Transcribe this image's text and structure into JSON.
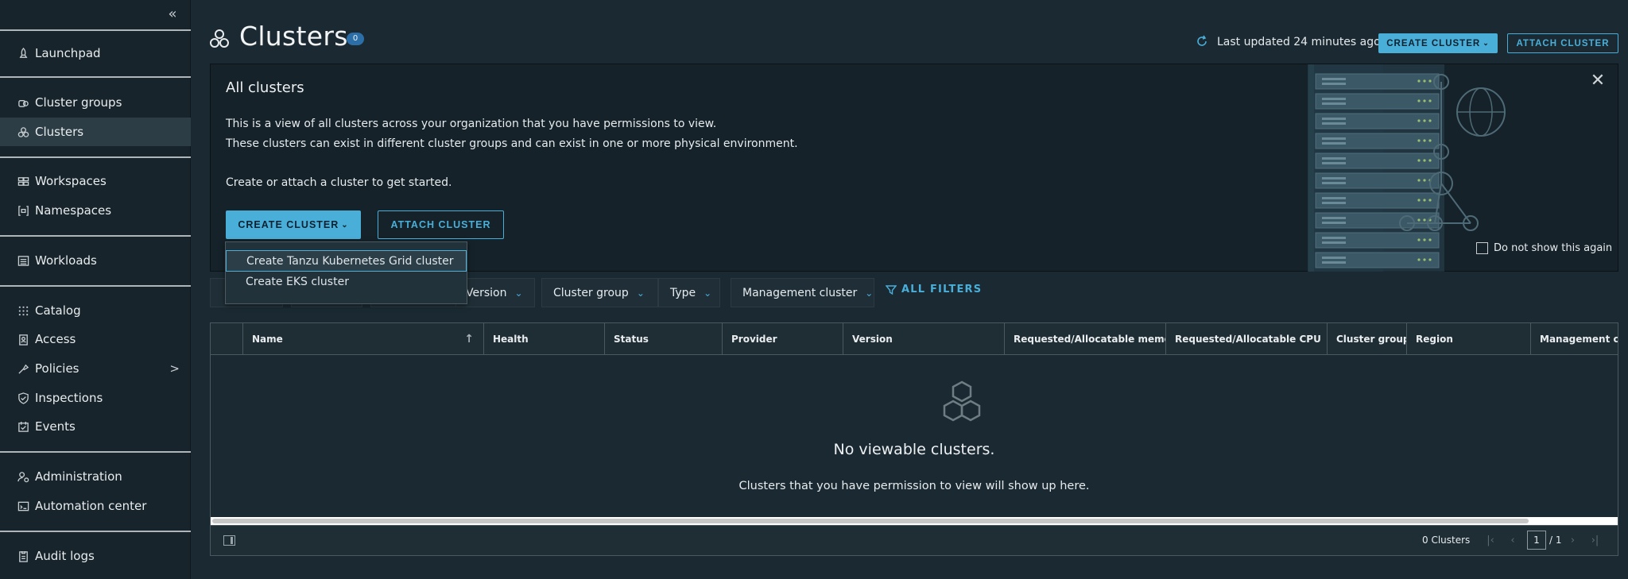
{
  "sidebar": {
    "collapse_icon": "double-chevron-left-icon",
    "items": [
      {
        "label": "Launchpad",
        "icon": "rocket-icon"
      },
      {
        "label": "Cluster groups",
        "icon": "cluster-groups-icon"
      },
      {
        "label": "Clusters",
        "icon": "clusters-icon",
        "active": true
      },
      {
        "label": "Workspaces",
        "icon": "workspaces-icon"
      },
      {
        "label": "Namespaces",
        "icon": "namespaces-icon"
      },
      {
        "label": "Workloads",
        "icon": "workloads-icon"
      },
      {
        "label": "Catalog",
        "icon": "catalog-icon"
      },
      {
        "label": "Access",
        "icon": "access-icon"
      },
      {
        "label": "Policies",
        "icon": "policies-icon"
      },
      {
        "label": "Inspections",
        "icon": "shield-icon"
      },
      {
        "label": "Events",
        "icon": "events-icon"
      },
      {
        "label": "Administration",
        "icon": "administration-icon"
      },
      {
        "label": "Automation center",
        "icon": "automation-icon"
      },
      {
        "label": "Audit logs",
        "icon": "audit-logs-icon"
      }
    ]
  },
  "header": {
    "title": "Clusters",
    "count": "0",
    "last_updated": "Last updated 24 minutes ago",
    "create_label": "CREATE CLUSTER",
    "attach_label": "ATTACH CLUSTER"
  },
  "banner": {
    "title": "All clusters",
    "line1": "This is a view of all clusters across your organization that you have permissions to view.",
    "line2": "These clusters can exist in different cluster groups and can exist in one or more physical environment.",
    "line3": "Create or attach a cluster to get started.",
    "create_label": "CREATE CLUSTER",
    "attach_label": "ATTACH CLUSTER",
    "dont_show": "Do not show this again"
  },
  "dropdown": {
    "items": [
      "Create Tanzu Kubernetes Grid cluster",
      "Create EKS cluster"
    ]
  },
  "filters": {
    "items": [
      "Version",
      "Cluster group",
      "Type",
      "Management cluster"
    ],
    "all_filters": "ALL FILTERS"
  },
  "grid": {
    "columns": [
      "Name",
      "Health",
      "Status",
      "Provider",
      "Version",
      "Requested/Allocatable memory",
      "Requested/Allocatable CPU",
      "Cluster group",
      "Region",
      "Management clust"
    ],
    "empty_title": "No viewable clusters.",
    "empty_sub": "Clusters that you have permission to view will show up here.",
    "footer_count": "0 Clusters",
    "page_current": "1",
    "page_total": "/ 1"
  },
  "colors": {
    "accent": "#49afd9",
    "background": "#1b2a32",
    "sidebar": "#17242b"
  }
}
